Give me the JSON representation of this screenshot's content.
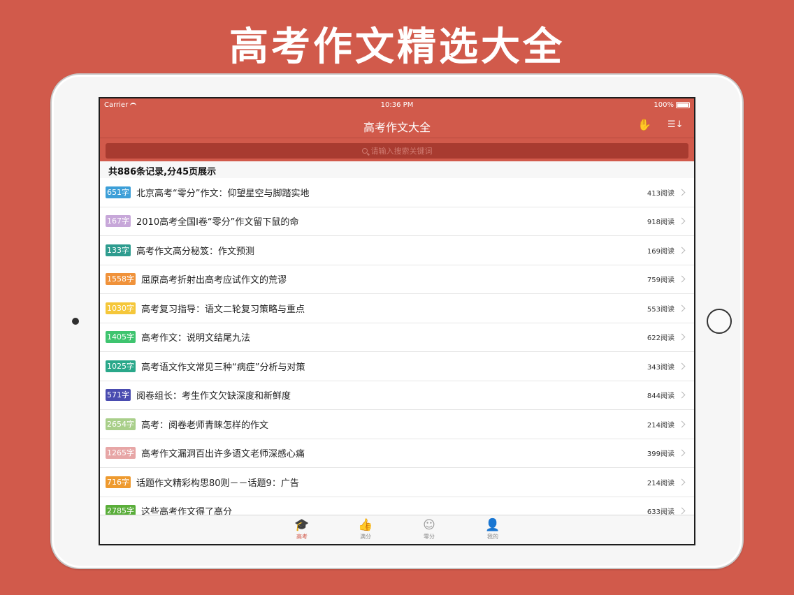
{
  "promo": {
    "title": "高考作文精选大全"
  },
  "status_bar": {
    "carrier": "Carrier",
    "time": "10:36 PM",
    "battery": "100%"
  },
  "nav": {
    "title": "高考作文大全",
    "hand_icon": "hand-icon",
    "sort_icon": "sort-icon"
  },
  "search": {
    "placeholder": "请输入搜索关键词"
  },
  "summary": "共886条记录,分45页展示",
  "items": [
    {
      "badge": "651字",
      "color": "#3d9fd8",
      "title": "北京高考“零分”作文：仰望星空与脚踏实地",
      "reads": "413阅读"
    },
    {
      "badge": "167字",
      "color": "#c7a7d9",
      "title": "2010高考全国I卷“零分”作文留下鼠的命",
      "reads": "918阅读"
    },
    {
      "badge": "133字",
      "color": "#2e9c8f",
      "title": "高考作文高分秘笈：作文预测",
      "reads": "169阅读"
    },
    {
      "badge": "1558字",
      "color": "#f0923a",
      "title": "屈原高考折射出高考应试作文的荒谬",
      "reads": "759阅读"
    },
    {
      "badge": "1030字",
      "color": "#f5c73a",
      "title": "高考复习指导：语文二轮复习策略与重点",
      "reads": "553阅读"
    },
    {
      "badge": "1405字",
      "color": "#3ec46f",
      "title": "高考作文：说明文结尾九法",
      "reads": "622阅读"
    },
    {
      "badge": "1025字",
      "color": "#2aa88a",
      "title": "高考语文作文常见三种“病症”分析与对策",
      "reads": "343阅读"
    },
    {
      "badge": "571字",
      "color": "#4a4cb0",
      "title": "阅卷组长：考生作文欠缺深度和新鲜度",
      "reads": "844阅读"
    },
    {
      "badge": "2654字",
      "color": "#a9cf8a",
      "title": "高考：阅卷老师青睐怎样的作文",
      "reads": "214阅读"
    },
    {
      "badge": "1265字",
      "color": "#e7a6a6",
      "title": "高考作文漏洞百出许多语文老师深感心痛",
      "reads": "399阅读"
    },
    {
      "badge": "716字",
      "color": "#ee9a2f",
      "title": "话题作文精彩构思80则－－话题9：广告",
      "reads": "214阅读"
    },
    {
      "badge": "2785字",
      "color": "#5aae3a",
      "title": "这些高考作文得了高分",
      "reads": "633阅读"
    }
  ],
  "tabs": [
    {
      "label": "高考",
      "icon": "graduation-cap-icon",
      "glyph": "🎓",
      "active": true
    },
    {
      "label": "满分",
      "icon": "thumbs-up-icon",
      "glyph": "👍",
      "active": false
    },
    {
      "label": "零分",
      "icon": "smiley-icon",
      "glyph": "☺",
      "active": false
    },
    {
      "label": "我的",
      "icon": "user-icon",
      "glyph": "👤",
      "active": false
    }
  ]
}
